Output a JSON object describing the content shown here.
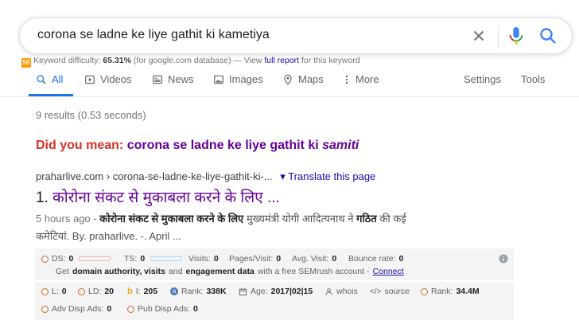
{
  "search": {
    "query": "corona se ladne ke liye gathit ki kametiya"
  },
  "keyword": {
    "icon_text": "50",
    "label": "Keyword difficulty:",
    "value": "65.31%",
    "db": "(for google.com database) — View",
    "link": "full report",
    "suffix": "for this keyword"
  },
  "tabs": [
    {
      "label": "All",
      "icon": "search-icon"
    },
    {
      "label": "Videos",
      "icon": "video-icon"
    },
    {
      "label": "News",
      "icon": "news-icon"
    },
    {
      "label": "Images",
      "icon": "image-icon"
    },
    {
      "label": "Maps",
      "icon": "map-pin-icon"
    },
    {
      "label": "More",
      "icon": "more-icon"
    },
    {
      "label": "Settings"
    },
    {
      "label": "Tools"
    }
  ],
  "stats": "9 results (0.53 seconds)",
  "did_you_mean": {
    "label": "Did you mean:",
    "prefix": "corona se ladne ke liye gathit ki",
    "correction": "samiti"
  },
  "result": {
    "url": "praharlive.com › corona-se-ladne-ke-liye-gathit-ki-...",
    "translate": "▾ Translate this page",
    "number": "1.",
    "title": "कोरोना संकट से मुकाबला करने के लिए ...",
    "date": "5 hours ago -",
    "snippet_b1": "कोरोना संकट से मुकाबला करने के लिए",
    "snippet_t1": "मुख्यमंत्री योगी आदित्यनाथ ने",
    "snippet_b2": "गठित",
    "snippet_t2": "की कई",
    "snippet_line2": "कमेटियां. By. praharlive. -. April ..."
  },
  "semrush": {
    "ds_label": "DS:",
    "ds_value": "0",
    "ts_label": "TS:",
    "ts_value": "0",
    "visits_label": "Visits:",
    "visits_value": "0",
    "pages_label": "Pages/Visit:",
    "pages_value": "0",
    "avg_label": "Avg. Visit:",
    "avg_value": "0",
    "bounce_label": "Bounce rate:",
    "bounce_value": "0",
    "cta_pre": "Get",
    "cta_bold": "domain authority, visits",
    "cta_mid": "and",
    "cta_bold2": "engagement data",
    "cta_post": "with a free SEMrush account -",
    "cta_link": "Connect"
  },
  "seo": {
    "l_label": "L:",
    "l_value": "0",
    "ld_label": "LD:",
    "ld_value": "20",
    "i_label": "I:",
    "i_value": "205",
    "rank_label": "Rank:",
    "rank_value": "338K",
    "age_label": "Age:",
    "age_value": "2017|02|15",
    "whois": "whois",
    "source": "source",
    "rank2_label": "Rank:",
    "rank2_value": "34.4M",
    "adv_label": "Adv Disp Ads:",
    "adv_value": "0",
    "pub_label": "Pub Disp Ads:",
    "pub_value": "0"
  },
  "colors": {
    "accent": "#1a73e8",
    "visited": "#660099",
    "link": "#1a0dab",
    "dym": "#d93025",
    "ring": "#d2692a"
  }
}
